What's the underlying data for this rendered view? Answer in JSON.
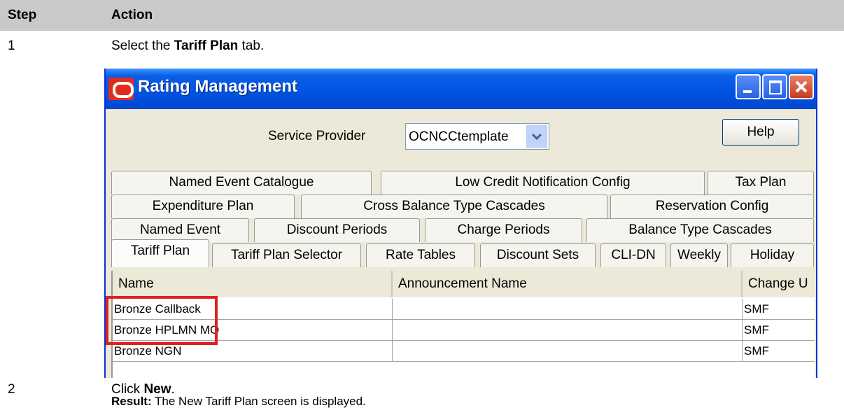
{
  "header": {
    "step": "Step",
    "action": "Action"
  },
  "steps": [
    {
      "num": "1",
      "pre": "Select the ",
      "bold": "Tariff Plan",
      "post": " tab."
    },
    {
      "num": "2",
      "pre": "Click ",
      "bold": "New",
      "post": "."
    }
  ],
  "result": {
    "label": "Result:",
    "text": " The New Tariff Plan screen is displayed."
  },
  "window": {
    "title": "Rating Management",
    "service_provider_label": "Service Provider",
    "service_provider_value": "OCNCCtemplate",
    "help_label": "Help",
    "tabs": {
      "row1": [
        "Named Event Catalogue",
        "Low Credit Notification Config",
        "Tax Plan"
      ],
      "row2": [
        "Expenditure Plan",
        "Cross Balance Type Cascades",
        "Reservation Config"
      ],
      "row3": [
        "Named Event",
        "Discount Periods",
        "Charge Periods",
        "Balance Type Cascades"
      ],
      "row4": [
        "Tariff Plan",
        "Tariff Plan Selector",
        "Rate Tables",
        "Discount Sets",
        "CLI-DN",
        "Weekly",
        "Holiday"
      ]
    },
    "selected_tab": "Tariff Plan",
    "columns": [
      "Name",
      "Announcement Name",
      "Change U"
    ],
    "rows": [
      {
        "name": "Bronze Callback",
        "announcement": "",
        "change": "SMF"
      },
      {
        "name": "Bronze HPLMN MO",
        "announcement": "",
        "change": "SMF"
      },
      {
        "name": "Bronze NGN",
        "announcement": "",
        "change": "SMF"
      }
    ]
  },
  "colors": {
    "highlight": "#e02020",
    "titlebar": "#0054e3",
    "header_bar": "#c9c9c9"
  }
}
